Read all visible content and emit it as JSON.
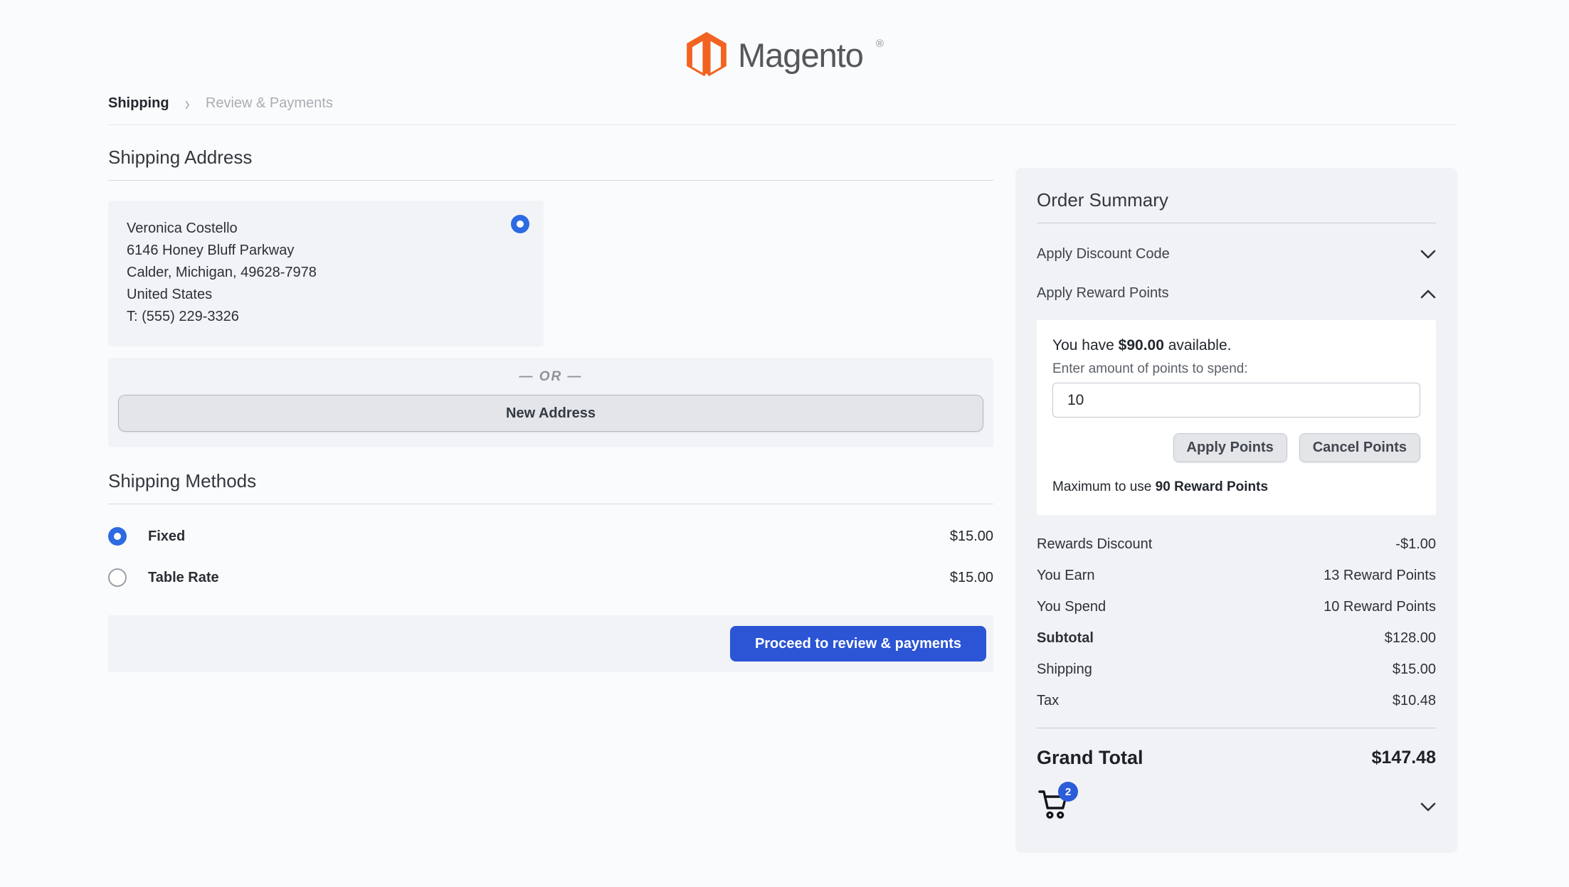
{
  "header": {
    "logo_text": "Magento",
    "logo_reg": "®"
  },
  "breadcrumb": {
    "items": [
      {
        "label": "Shipping"
      },
      {
        "label": "Review & Payments"
      }
    ]
  },
  "shipping_address": {
    "title": "Shipping Address",
    "card": {
      "name": "Veronica Costello",
      "street": "6146 Honey Bluff Parkway",
      "city_line": "Calder, Michigan, 49628-7978",
      "country": "United States",
      "phone": "T: (555) 229-3326"
    },
    "or_divider": "— OR —",
    "new_address_label": "New Address"
  },
  "shipping_methods": {
    "title": "Shipping Methods",
    "methods": [
      {
        "label": "Fixed",
        "price": "$15.00",
        "selected": true
      },
      {
        "label": "Table Rate",
        "price": "$15.00",
        "selected": false
      }
    ],
    "proceed_label": "Proceed to review & payments"
  },
  "order_summary": {
    "title": "Order Summary",
    "discount_toggle_label": "Apply Discount Code",
    "reward_toggle_label": "Apply Reward Points",
    "reward_panel": {
      "available_prefix": "You have ",
      "available_amount": "$90.00",
      "available_suffix": " available.",
      "points_label": "Enter amount of points to spend:",
      "points_value": "10",
      "apply_label": "Apply Points",
      "cancel_label": "Cancel Points",
      "max_prefix": "Maximum to use ",
      "max_value": "90 Reward Points"
    },
    "totals": [
      {
        "label": "Rewards Discount",
        "value": "-$1.00"
      },
      {
        "label": "You Earn",
        "value": "13 Reward Points"
      },
      {
        "label": "You Spend",
        "value": "10 Reward Points"
      },
      {
        "label": "Subtotal",
        "value": "$128.00"
      },
      {
        "label": "Shipping",
        "value": "$15.00"
      },
      {
        "label": "Tax",
        "value": "$10.48"
      }
    ],
    "grand_total": {
      "label": "Grand Total",
      "value": "$147.48"
    },
    "cart": {
      "badge_count": "2"
    }
  },
  "colors": {
    "accent_blue": "#2b55d4",
    "radio_blue": "#2e6ae2",
    "badge_blue": "#2b5cd9",
    "logo_orange": "#f26322",
    "panel_gray": "#f1f2f5"
  }
}
